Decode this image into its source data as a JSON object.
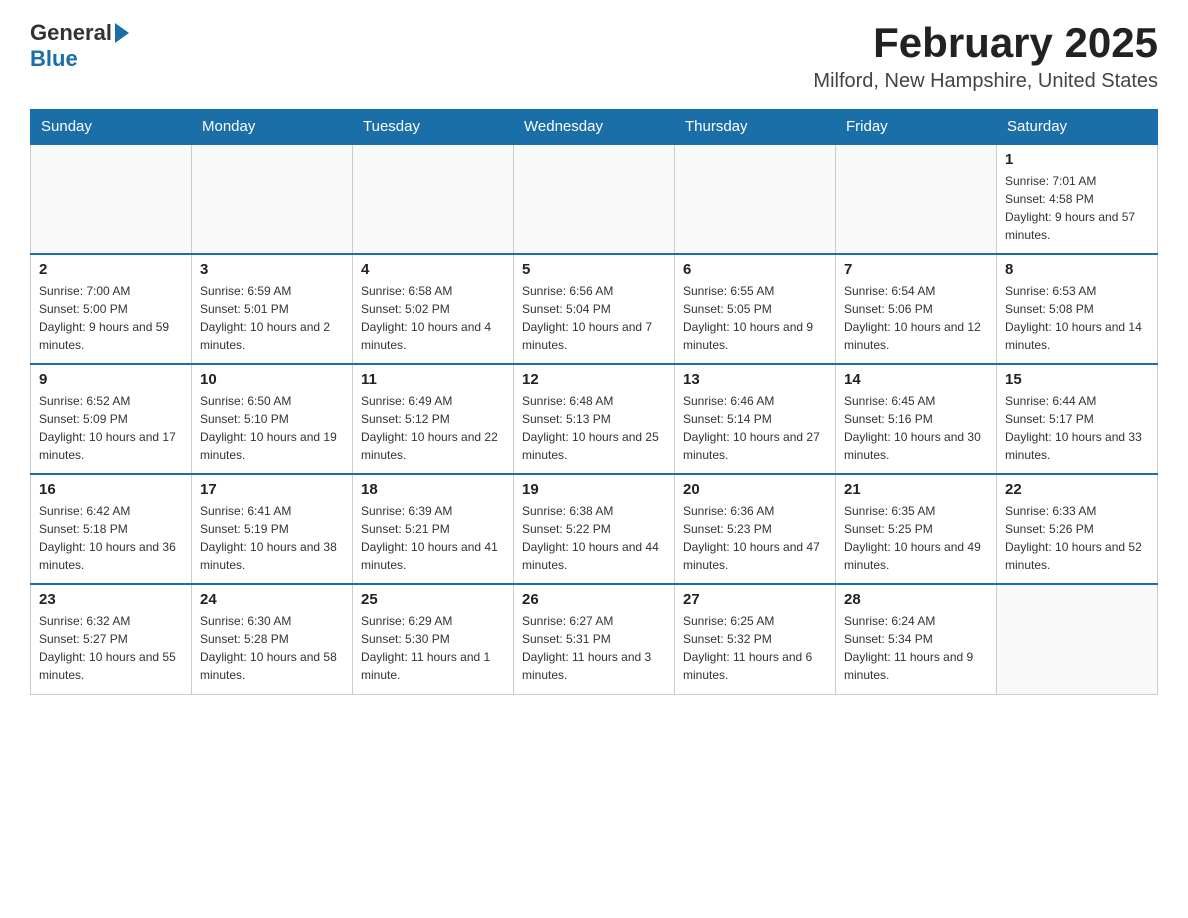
{
  "logo": {
    "general": "General",
    "blue": "Blue"
  },
  "header": {
    "title": "February 2025",
    "subtitle": "Milford, New Hampshire, United States"
  },
  "days_of_week": [
    "Sunday",
    "Monday",
    "Tuesday",
    "Wednesday",
    "Thursday",
    "Friday",
    "Saturday"
  ],
  "weeks": [
    [
      {
        "day": "",
        "info": ""
      },
      {
        "day": "",
        "info": ""
      },
      {
        "day": "",
        "info": ""
      },
      {
        "day": "",
        "info": ""
      },
      {
        "day": "",
        "info": ""
      },
      {
        "day": "",
        "info": ""
      },
      {
        "day": "1",
        "info": "Sunrise: 7:01 AM\nSunset: 4:58 PM\nDaylight: 9 hours and 57 minutes."
      }
    ],
    [
      {
        "day": "2",
        "info": "Sunrise: 7:00 AM\nSunset: 5:00 PM\nDaylight: 9 hours and 59 minutes."
      },
      {
        "day": "3",
        "info": "Sunrise: 6:59 AM\nSunset: 5:01 PM\nDaylight: 10 hours and 2 minutes."
      },
      {
        "day": "4",
        "info": "Sunrise: 6:58 AM\nSunset: 5:02 PM\nDaylight: 10 hours and 4 minutes."
      },
      {
        "day": "5",
        "info": "Sunrise: 6:56 AM\nSunset: 5:04 PM\nDaylight: 10 hours and 7 minutes."
      },
      {
        "day": "6",
        "info": "Sunrise: 6:55 AM\nSunset: 5:05 PM\nDaylight: 10 hours and 9 minutes."
      },
      {
        "day": "7",
        "info": "Sunrise: 6:54 AM\nSunset: 5:06 PM\nDaylight: 10 hours and 12 minutes."
      },
      {
        "day": "8",
        "info": "Sunrise: 6:53 AM\nSunset: 5:08 PM\nDaylight: 10 hours and 14 minutes."
      }
    ],
    [
      {
        "day": "9",
        "info": "Sunrise: 6:52 AM\nSunset: 5:09 PM\nDaylight: 10 hours and 17 minutes."
      },
      {
        "day": "10",
        "info": "Sunrise: 6:50 AM\nSunset: 5:10 PM\nDaylight: 10 hours and 19 minutes."
      },
      {
        "day": "11",
        "info": "Sunrise: 6:49 AM\nSunset: 5:12 PM\nDaylight: 10 hours and 22 minutes."
      },
      {
        "day": "12",
        "info": "Sunrise: 6:48 AM\nSunset: 5:13 PM\nDaylight: 10 hours and 25 minutes."
      },
      {
        "day": "13",
        "info": "Sunrise: 6:46 AM\nSunset: 5:14 PM\nDaylight: 10 hours and 27 minutes."
      },
      {
        "day": "14",
        "info": "Sunrise: 6:45 AM\nSunset: 5:16 PM\nDaylight: 10 hours and 30 minutes."
      },
      {
        "day": "15",
        "info": "Sunrise: 6:44 AM\nSunset: 5:17 PM\nDaylight: 10 hours and 33 minutes."
      }
    ],
    [
      {
        "day": "16",
        "info": "Sunrise: 6:42 AM\nSunset: 5:18 PM\nDaylight: 10 hours and 36 minutes."
      },
      {
        "day": "17",
        "info": "Sunrise: 6:41 AM\nSunset: 5:19 PM\nDaylight: 10 hours and 38 minutes."
      },
      {
        "day": "18",
        "info": "Sunrise: 6:39 AM\nSunset: 5:21 PM\nDaylight: 10 hours and 41 minutes."
      },
      {
        "day": "19",
        "info": "Sunrise: 6:38 AM\nSunset: 5:22 PM\nDaylight: 10 hours and 44 minutes."
      },
      {
        "day": "20",
        "info": "Sunrise: 6:36 AM\nSunset: 5:23 PM\nDaylight: 10 hours and 47 minutes."
      },
      {
        "day": "21",
        "info": "Sunrise: 6:35 AM\nSunset: 5:25 PM\nDaylight: 10 hours and 49 minutes."
      },
      {
        "day": "22",
        "info": "Sunrise: 6:33 AM\nSunset: 5:26 PM\nDaylight: 10 hours and 52 minutes."
      }
    ],
    [
      {
        "day": "23",
        "info": "Sunrise: 6:32 AM\nSunset: 5:27 PM\nDaylight: 10 hours and 55 minutes."
      },
      {
        "day": "24",
        "info": "Sunrise: 6:30 AM\nSunset: 5:28 PM\nDaylight: 10 hours and 58 minutes."
      },
      {
        "day": "25",
        "info": "Sunrise: 6:29 AM\nSunset: 5:30 PM\nDaylight: 11 hours and 1 minute."
      },
      {
        "day": "26",
        "info": "Sunrise: 6:27 AM\nSunset: 5:31 PM\nDaylight: 11 hours and 3 minutes."
      },
      {
        "day": "27",
        "info": "Sunrise: 6:25 AM\nSunset: 5:32 PM\nDaylight: 11 hours and 6 minutes."
      },
      {
        "day": "28",
        "info": "Sunrise: 6:24 AM\nSunset: 5:34 PM\nDaylight: 11 hours and 9 minutes."
      },
      {
        "day": "",
        "info": ""
      }
    ]
  ]
}
